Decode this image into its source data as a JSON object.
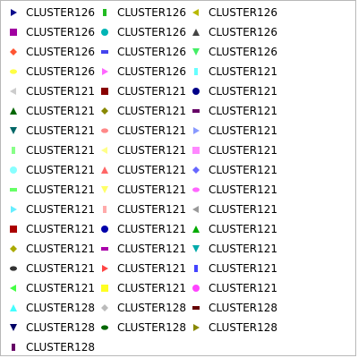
{
  "legend": {
    "entries": [
      {
        "label": "CLUSTER126",
        "marker": "triangle-right",
        "color": "#0c0c8c"
      },
      {
        "label": "CLUSTER126",
        "marker": "bar-vertical",
        "color": "#22bb22"
      },
      {
        "label": "CLUSTER126",
        "marker": "triangle-left",
        "color": "#b8b800"
      },
      {
        "label": "CLUSTER126",
        "marker": "square",
        "color": "#a000a0"
      },
      {
        "label": "CLUSTER126",
        "marker": "circle",
        "color": "#00b4b4"
      },
      {
        "label": "CLUSTER126",
        "marker": "triangle-up",
        "color": "#444444"
      },
      {
        "label": "CLUSTER126",
        "marker": "diamond",
        "color": "#ff5533"
      },
      {
        "label": "CLUSTER126",
        "marker": "bar-horizontal",
        "color": "#4444ee"
      },
      {
        "label": "CLUSTER126",
        "marker": "triangle-down",
        "color": "#44ee66"
      },
      {
        "label": "CLUSTER126",
        "marker": "ellipse",
        "color": "#ffff44"
      },
      {
        "label": "CLUSTER126",
        "marker": "triangle-right",
        "color": "#ff66ff"
      },
      {
        "label": "CLUSTER121",
        "marker": "bar-vertical",
        "color": "#66ffff"
      },
      {
        "label": "CLUSTER121",
        "marker": "triangle-left",
        "color": "#cccccc"
      },
      {
        "label": "CLUSTER121",
        "marker": "square",
        "color": "#880000"
      },
      {
        "label": "CLUSTER121",
        "marker": "circle",
        "color": "#000088"
      },
      {
        "label": "CLUSTER121",
        "marker": "triangle-up",
        "color": "#006600"
      },
      {
        "label": "CLUSTER121",
        "marker": "diamond",
        "color": "#888800"
      },
      {
        "label": "CLUSTER121",
        "marker": "bar-horizontal",
        "color": "#660066"
      },
      {
        "label": "CLUSTER121",
        "marker": "triangle-down",
        "color": "#006666"
      },
      {
        "label": "CLUSTER121",
        "marker": "ellipse",
        "color": "#ff8888"
      },
      {
        "label": "CLUSTER121",
        "marker": "triangle-right",
        "color": "#8899ff"
      },
      {
        "label": "CLUSTER121",
        "marker": "bar-vertical",
        "color": "#88ff88"
      },
      {
        "label": "CLUSTER121",
        "marker": "triangle-left",
        "color": "#ffff88"
      },
      {
        "label": "CLUSTER121",
        "marker": "square",
        "color": "#ff88ff"
      },
      {
        "label": "CLUSTER121",
        "marker": "circle",
        "color": "#88ffff"
      },
      {
        "label": "CLUSTER121",
        "marker": "triangle-up",
        "color": "#ff6666"
      },
      {
        "label": "CLUSTER121",
        "marker": "diamond",
        "color": "#6666ff"
      },
      {
        "label": "CLUSTER121",
        "marker": "bar-horizontal",
        "color": "#66ff66"
      },
      {
        "label": "CLUSTER121",
        "marker": "triangle-down",
        "color": "#ffff66"
      },
      {
        "label": "CLUSTER121",
        "marker": "ellipse",
        "color": "#ff66ff"
      },
      {
        "label": "CLUSTER121",
        "marker": "triangle-right",
        "color": "#66eeff"
      },
      {
        "label": "CLUSTER121",
        "marker": "bar-vertical",
        "color": "#ffaaaa"
      },
      {
        "label": "CLUSTER121",
        "marker": "triangle-left",
        "color": "#999999"
      },
      {
        "label": "CLUSTER121",
        "marker": "square",
        "color": "#aa0000"
      },
      {
        "label": "CLUSTER121",
        "marker": "circle",
        "color": "#0000aa"
      },
      {
        "label": "CLUSTER121",
        "marker": "triangle-up",
        "color": "#00aa00"
      },
      {
        "label": "CLUSTER121",
        "marker": "diamond",
        "color": "#aaaa00"
      },
      {
        "label": "CLUSTER121",
        "marker": "bar-horizontal",
        "color": "#aa00aa"
      },
      {
        "label": "CLUSTER121",
        "marker": "triangle-down",
        "color": "#00aaaa"
      },
      {
        "label": "CLUSTER121",
        "marker": "ellipse",
        "color": "#333333"
      },
      {
        "label": "CLUSTER121",
        "marker": "triangle-right",
        "color": "#ff4444"
      },
      {
        "label": "CLUSTER121",
        "marker": "bar-vertical",
        "color": "#4444ff"
      },
      {
        "label": "CLUSTER121",
        "marker": "triangle-left",
        "color": "#44ff44"
      },
      {
        "label": "CLUSTER121",
        "marker": "square",
        "color": "#ffff22"
      },
      {
        "label": "CLUSTER121",
        "marker": "circle",
        "color": "#ff44ff"
      },
      {
        "label": "CLUSTER128",
        "marker": "triangle-up",
        "color": "#44ffff"
      },
      {
        "label": "CLUSTER128",
        "marker": "diamond",
        "color": "#bbbbbb"
      },
      {
        "label": "CLUSTER128",
        "marker": "bar-horizontal",
        "color": "#660000"
      },
      {
        "label": "CLUSTER128",
        "marker": "triangle-down",
        "color": "#000066"
      },
      {
        "label": "CLUSTER128",
        "marker": "ellipse",
        "color": "#006600"
      },
      {
        "label": "CLUSTER128",
        "marker": "triangle-right",
        "color": "#888800"
      },
      {
        "label": "CLUSTER128",
        "marker": "bar-vertical",
        "color": "#660066"
      }
    ]
  }
}
